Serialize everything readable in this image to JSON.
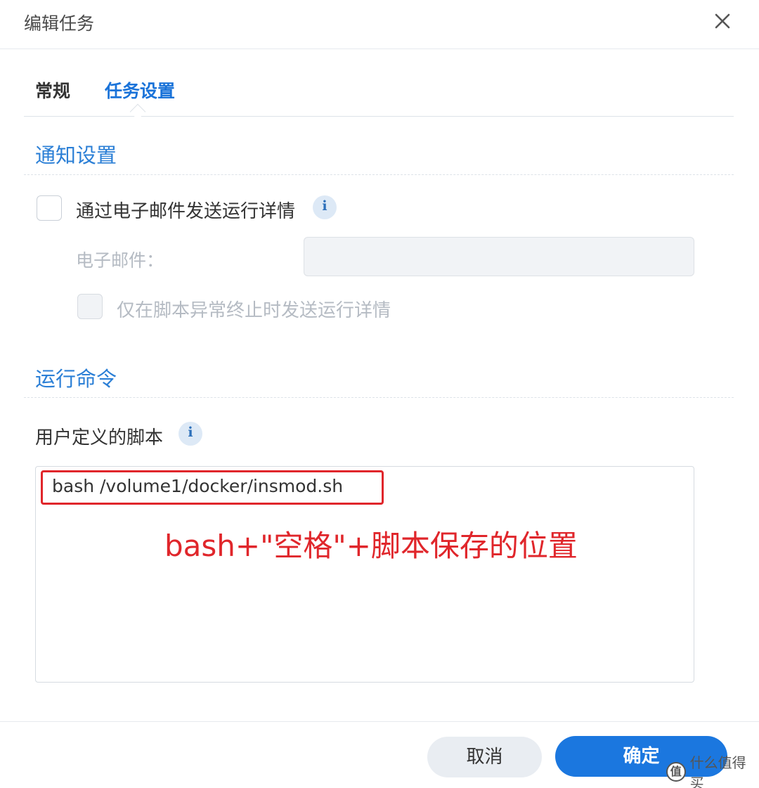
{
  "dialog": {
    "title": "编辑任务",
    "close_icon": "close-icon"
  },
  "tabs": [
    {
      "label": "常规",
      "active": false
    },
    {
      "label": "任务设置",
      "active": true
    }
  ],
  "notification": {
    "section_title": "通知设置",
    "send_email_label": "通过电子邮件发送运行详情",
    "send_email_checked": false,
    "email_label": "电子邮件：",
    "email_value": "",
    "abnormal_only_label": "仅在脚本异常终止时发送运行详情",
    "abnormal_only_checked": false
  },
  "run_command": {
    "section_title": "运行命令",
    "script_label": "用户定义的脚本",
    "script_value": "bash /volume1/docker/insmod.sh",
    "annotation": "bash+\"空格\"+脚本保存的位置"
  },
  "footer": {
    "cancel_label": "取消",
    "ok_label": "确定"
  },
  "watermark": {
    "icon": "值",
    "text": "什么值得买"
  },
  "colors": {
    "accent": "#1b77df",
    "section_title": "#2b7fd6",
    "annotation_red": "#e0262b"
  }
}
